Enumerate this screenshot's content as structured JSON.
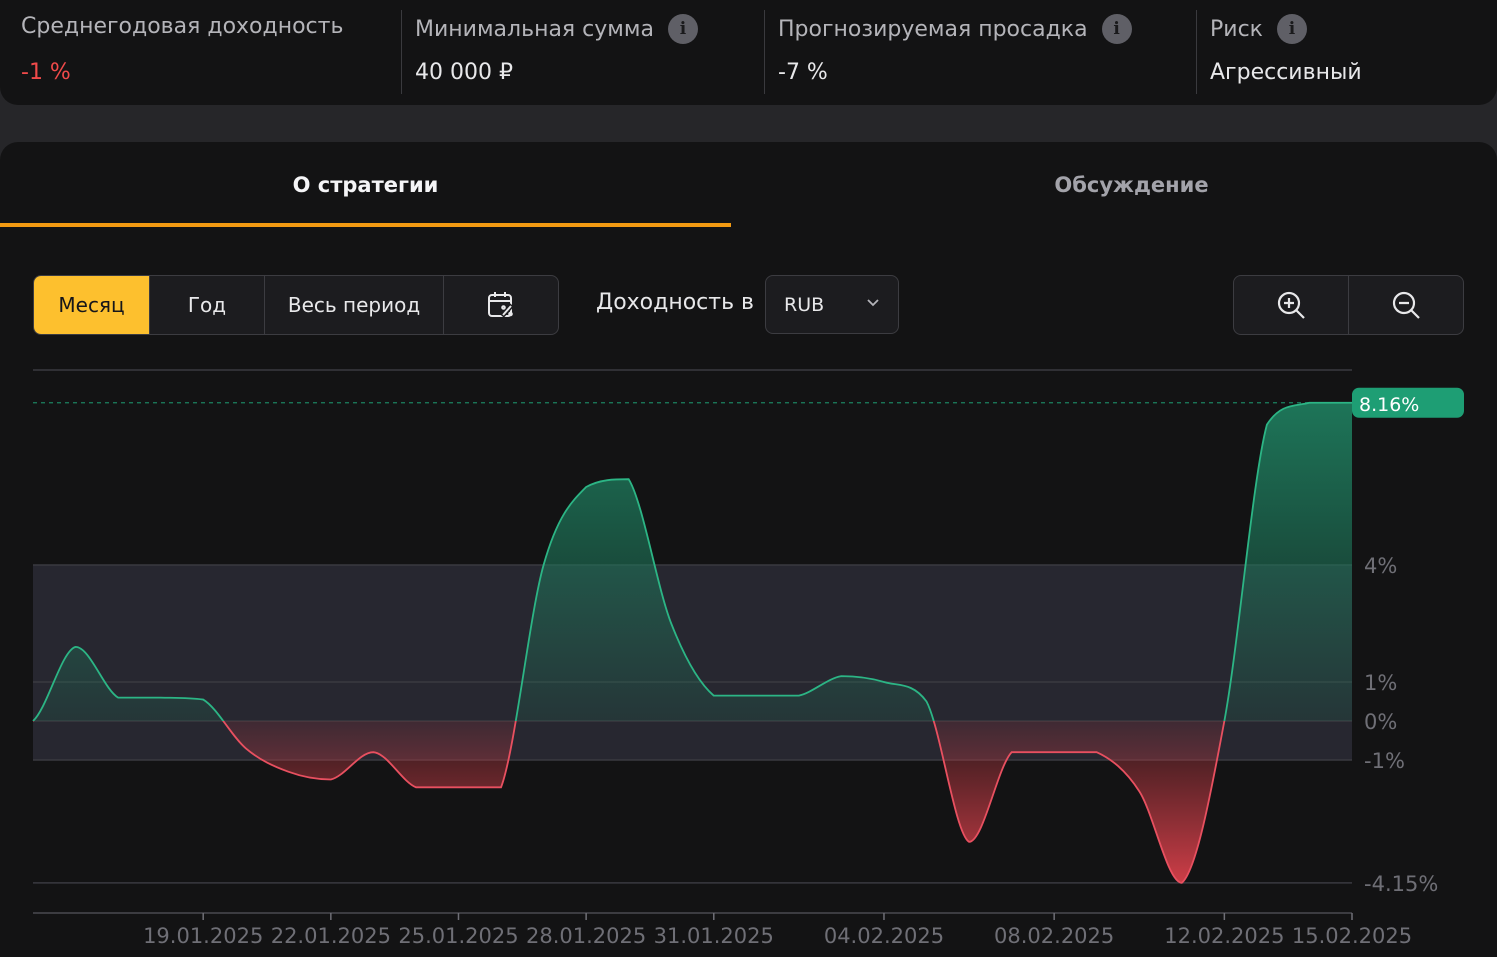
{
  "stats": [
    {
      "label": "Среднегодовая доходность",
      "value": "-1 %",
      "info": false,
      "negative": true
    },
    {
      "label": "Минимальная сумма",
      "value": "40 000 ₽",
      "info": true,
      "negative": false
    },
    {
      "label": "Прогнозируемая просадка",
      "value": "-7 %",
      "info": true,
      "negative": false
    },
    {
      "label": "Риск",
      "value": "Агрессивный",
      "info": true,
      "negative": false
    }
  ],
  "tabs": {
    "about": "О стратегии",
    "discussion": "Обсуждение"
  },
  "period_buttons": {
    "month": "Месяц",
    "year": "Год",
    "all": "Весь период",
    "selected": "month"
  },
  "currency": {
    "label": "Доходность в",
    "value": "RUB"
  },
  "colors": {
    "accent": "#fdc02e",
    "tab_underline": "#f29a12",
    "positive": "#1e9e74",
    "negative": "#e0444e"
  },
  "chart_data": {
    "type": "area",
    "x_ticks": [
      "19.01.2025",
      "22.01.2025",
      "25.01.2025",
      "28.01.2025",
      "31.01.2025",
      "04.02.2025",
      "08.02.2025",
      "12.02.2025",
      "15.02.2025"
    ],
    "y_ticks": [
      "4%",
      "1%",
      "0%",
      "-1%",
      "-4.15%"
    ],
    "y_tick_values": [
      4,
      1,
      0,
      -1,
      -4.15
    ],
    "highlight_band": [
      -1,
      4
    ],
    "last_value_label": "8.16%",
    "last_value": 8.16,
    "x": [
      "15.01.2025",
      "16.01.2025",
      "17.01.2025",
      "18.01.2025",
      "19.01.2025",
      "20.01.2025",
      "21.01.2025",
      "22.01.2025",
      "23.01.2025",
      "24.01.2025",
      "25.01.2025",
      "26.01.2025",
      "27.01.2025",
      "28.01.2025",
      "29.01.2025",
      "30.01.2025",
      "31.01.2025",
      "01.02.2025",
      "02.02.2025",
      "03.02.2025",
      "04.02.2025",
      "05.02.2025",
      "06.02.2025",
      "07.02.2025",
      "08.02.2025",
      "09.02.2025",
      "10.02.2025",
      "11.02.2025",
      "12.02.2025",
      "13.02.2025",
      "14.02.2025",
      "15.02.2025"
    ],
    "values": [
      0,
      1.9,
      0.6,
      0.6,
      0.55,
      -0.7,
      -1.3,
      -1.5,
      -0.8,
      -1.7,
      -1.7,
      -1.7,
      4.0,
      6.0,
      6.2,
      2.5,
      0.65,
      0.65,
      0.65,
      1.15,
      1.0,
      0.5,
      -3.1,
      -0.8,
      -0.8,
      -0.8,
      -1.8,
      -4.15,
      0,
      7.6,
      8.16,
      8.16
    ]
  }
}
